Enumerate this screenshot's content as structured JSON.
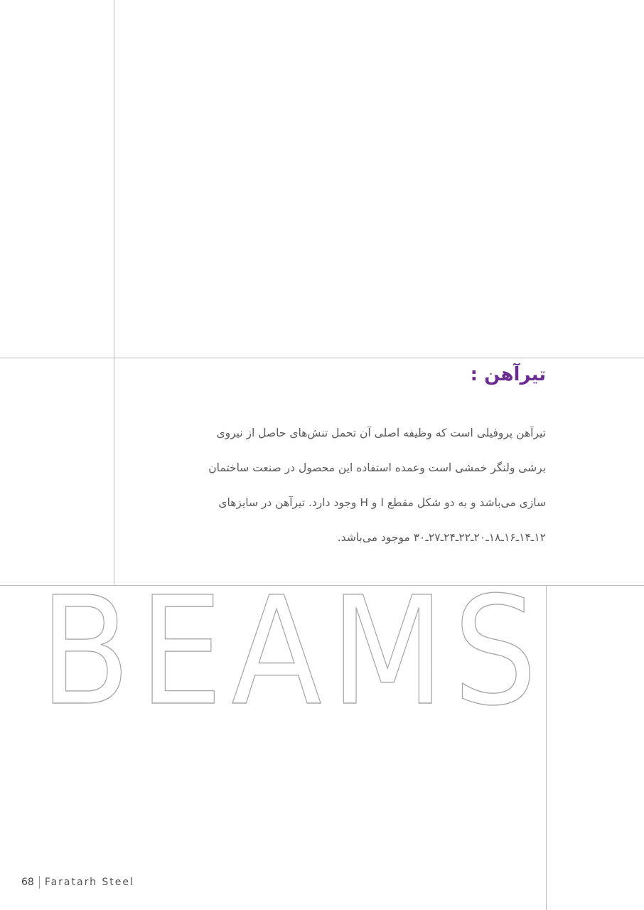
{
  "heading": "تیرآهن :",
  "body_lines": [
    "تیرآهن پروفیلی است که وظیفه اصلی آن تحمل تنش‌های حاصل از نیروی",
    "برشی ولنگر خمشی است وعمده استفاده این محصول در صنعت ساختمان",
    "سازی می‌باشد و به دو شکل مقطع I و H وجود دارد. تیرآهن در سایزهای",
    "۱۲ـ۱۴ـ۱۶ـ۱۸ـ۲۰ـ۲۲ـ۲۴ـ۲۷ـ۳۰ موجود می‌باشد."
  ],
  "big_word": "BEAMS",
  "footer": {
    "page_number": "68",
    "brand": "Faratarh Steel"
  },
  "colors": {
    "heading": "#6a2c91",
    "body_text": "#5a5a5a",
    "rules": "#bdbdbd",
    "outline": "#a6a6a6"
  }
}
